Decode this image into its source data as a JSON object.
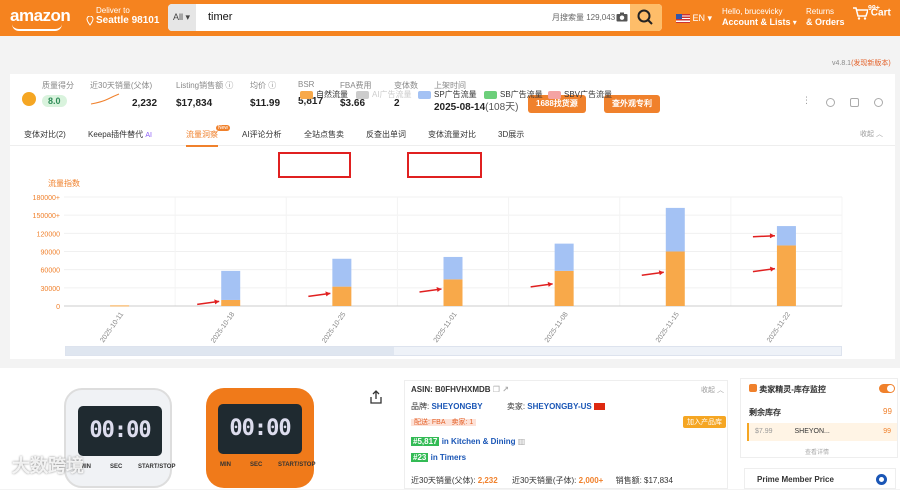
{
  "header": {
    "logo": "amazon",
    "deliver_line1": "Deliver to",
    "deliver_line2": "Seattle 98101",
    "search_category": "All",
    "search_query": "timer",
    "search_volume": "月搜索量 129,043",
    "language": "EN",
    "hello": "Hello, brucevicky",
    "account": "Account & Lists",
    "returns": "Returns",
    "orders": "& Orders",
    "cart_count": "99+",
    "cart": "Cart"
  },
  "version": {
    "num": "v4.8.1",
    "link": "(发现新版本)"
  },
  "stats": [
    {
      "label": "质量得分",
      "value": "8.0"
    },
    {
      "label": "近30天销量(父体)",
      "value": "2,232"
    },
    {
      "label": "Listing销售额",
      "value": "$17,834"
    },
    {
      "label": "均价",
      "value": "$11.99"
    },
    {
      "label": "BSR",
      "value": "5,817"
    },
    {
      "label": "FBA费用",
      "value": "$3.66"
    },
    {
      "label": "变体数",
      "value": "2"
    },
    {
      "label": "上架时间",
      "value": "2025-08-14",
      "extra": "(108天)"
    }
  ],
  "buttons": {
    "source_1688": "1688找货源",
    "patent": "查外观专利"
  },
  "tabs": [
    "变体对比(2)",
    "Keepa插件替代",
    "流量洞察",
    "AI评论分析",
    "全站点售卖",
    "反查出单词",
    "变体流量对比",
    "3D展示"
  ],
  "tab_ai": "AI",
  "tab_new": "New",
  "collapse": "收起",
  "legend": [
    {
      "name": "自然流量",
      "color": "#f8a94a"
    },
    {
      "name": "AI广告流量",
      "color": "#cccccc"
    },
    {
      "name": "SP广告流量",
      "color": "#a4c2f4"
    },
    {
      "name": "SB广告流量",
      "color": "#6ccf7a"
    },
    {
      "name": "SBV广告流量",
      "color": "#f4a3a3"
    }
  ],
  "chart_data": {
    "type": "bar",
    "stacked": true,
    "ylabel": "流量指数",
    "ylim": [
      0,
      180000
    ],
    "yticks": [
      "0",
      "30000",
      "60000",
      "90000",
      "120000",
      "150000+",
      "180000+"
    ],
    "categories": [
      "2025-10-11",
      "2025-10-18",
      "2025-10-25",
      "2025-11-01",
      "2025-11-08",
      "2025-11-15",
      "2025-11-22"
    ],
    "series": [
      {
        "name": "自然流量",
        "values": [
          1000,
          10000,
          32000,
          44000,
          58000,
          90000,
          100000
        ]
      },
      {
        "name": "SP广告流量",
        "values": [
          0,
          48000,
          46000,
          37000,
          45000,
          72000,
          32000
        ]
      }
    ]
  },
  "product": {
    "asin": "ASIN: B0FHVHXMDB",
    "collapse": "收起",
    "brand_label": "品牌:",
    "brand": "SHEYONGBY",
    "seller_label": "卖家:",
    "seller": "SHEYONGBY-US",
    "ship": "配送: FBA",
    "sellers": "卖家: 1",
    "add_btn": "加入产品库",
    "rank1": "#5,817",
    "rank1_cat": "in Kitchen & Dining",
    "rank2": "#23",
    "rank2_cat": "in Timers",
    "sales_parent_label": "近30天销量(父体):",
    "sales_parent": "2,232",
    "sales_child_label": "近30天销量(子体):",
    "sales_child": "2,000+",
    "revenue": "销售额: $17,834"
  },
  "timer_labels": [
    "MIN",
    "SEC",
    "START/STOP"
  ],
  "timer_display": "00:00",
  "side": {
    "title": "卖家精灵-库存监控",
    "inventory_label": "剩余库存",
    "inventory_value": "99",
    "row_price": "$7.99",
    "row_seller": "SHEYON...",
    "row_qty": "99",
    "link": "查看详情"
  },
  "prime": "Prime Member Price",
  "watermark": "大数跨境"
}
